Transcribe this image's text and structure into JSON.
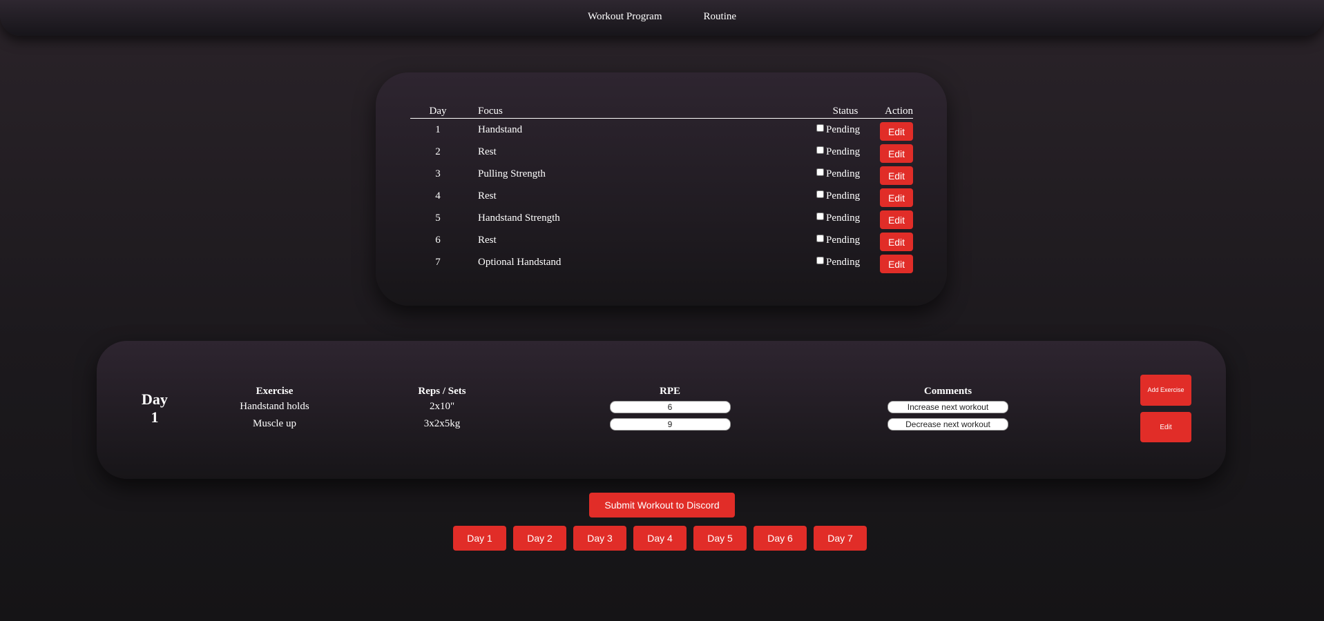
{
  "nav": {
    "items": [
      "Workout Program",
      "Routine"
    ]
  },
  "program": {
    "headers": {
      "day": "Day",
      "focus": "Focus",
      "status": "Status",
      "action": "Action"
    },
    "rows": [
      {
        "day": "1",
        "focus": "Handstand",
        "status": "Pending",
        "action": "Edit"
      },
      {
        "day": "2",
        "focus": "Rest",
        "status": "Pending",
        "action": "Edit"
      },
      {
        "day": "3",
        "focus": "Pulling Strength",
        "status": "Pending",
        "action": "Edit"
      },
      {
        "day": "4",
        "focus": "Rest",
        "status": "Pending",
        "action": "Edit"
      },
      {
        "day": "5",
        "focus": "Handstand Strength",
        "status": "Pending",
        "action": "Edit"
      },
      {
        "day": "6",
        "focus": "Rest",
        "status": "Pending",
        "action": "Edit"
      },
      {
        "day": "7",
        "focus": "Optional Handstand",
        "status": "Pending",
        "action": "Edit"
      }
    ]
  },
  "day_detail": {
    "title_line1": "Day",
    "title_line2": "1",
    "headers": {
      "exercise": "Exercise",
      "reps": "Reps / Sets",
      "rpe": "RPE",
      "comments": "Comments"
    },
    "rows": [
      {
        "exercise": "Handstand holds",
        "reps": "2x10\"",
        "rpe": "6",
        "comment": "Increase next workout"
      },
      {
        "exercise": "Muscle up",
        "reps": "3x2x5kg",
        "rpe": "9",
        "comment": "Decrease next workout"
      }
    ],
    "add_label": "Add Exercise",
    "edit_label": "Edit"
  },
  "submit_label": "Submit Workout to Discord",
  "day_buttons": [
    "Day 1",
    "Day 2",
    "Day 3",
    "Day 4",
    "Day 5",
    "Day 6",
    "Day 7"
  ],
  "colors": {
    "accent": "#e12d28",
    "background": "#1c191d",
    "card": "#2e2530"
  }
}
